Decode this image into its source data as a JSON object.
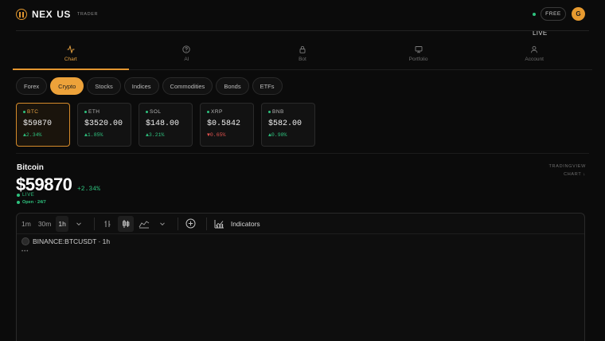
{
  "brand": {
    "name_a": "NEX",
    "name_b": "US",
    "tagline": "TRADER"
  },
  "header": {
    "plan": "FREE",
    "avatar_initial": "G",
    "live_label": "LIVE"
  },
  "nav": [
    {
      "label": "Chart",
      "icon": "activity-icon",
      "active": true
    },
    {
      "label": "AI",
      "icon": "help-circle-icon",
      "active": false
    },
    {
      "label": "Bot",
      "icon": "lock-icon",
      "active": false
    },
    {
      "label": "Portfolio",
      "icon": "monitor-icon",
      "active": false
    },
    {
      "label": "Account",
      "icon": "user-icon",
      "active": false
    }
  ],
  "markets": [
    "Forex",
    "Crypto",
    "Stocks",
    "Indices",
    "Commodities",
    "Bonds",
    "ETFs"
  ],
  "active_market": "Crypto",
  "tickers": [
    {
      "symbol": "BTC",
      "price": "$59870",
      "change": "▲2.34%",
      "direction": "up"
    },
    {
      "symbol": "ETH",
      "price": "$3520.00",
      "change": "▲1.85%",
      "direction": "up"
    },
    {
      "symbol": "SOL",
      "price": "$148.00",
      "change": "▲3.21%",
      "direction": "up"
    },
    {
      "symbol": "XRP",
      "price": "$0.5842",
      "change": "▼0.65%",
      "direction": "down"
    },
    {
      "symbol": "BNB",
      "price": "$582.00",
      "change": "▲0.98%",
      "direction": "up"
    }
  ],
  "asset": {
    "name": "Bitcoin",
    "price": "$59870",
    "change": "+2.34%",
    "live": "LIVE",
    "session": "Open · 24/7",
    "source_line1": "TRADINGVIEW",
    "source_line2": "CHART ↓"
  },
  "chart_toolbar": {
    "intervals": [
      "1m",
      "30m",
      "1h"
    ],
    "active_interval": "1h",
    "indicators_label": "Indicators"
  },
  "chart": {
    "symbol": "BINANCE:BTCUSDT · 1h",
    "loading": "•••"
  },
  "colors": {
    "accent": "#eda23a",
    "up": "#2ec27e",
    "down": "#e0524e",
    "background": "#0b0b0b"
  }
}
